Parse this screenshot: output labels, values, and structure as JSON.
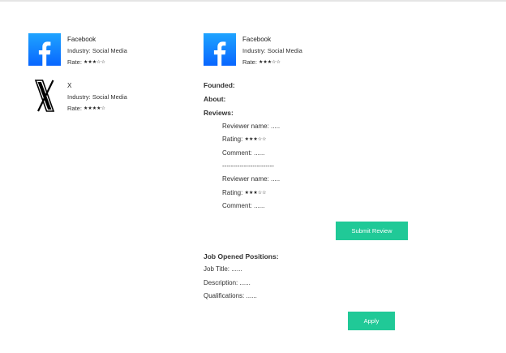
{
  "companies": [
    {
      "name": "Facebook",
      "industry": "Industry: Social Media",
      "rate_label": "Rate:",
      "stars": "★★★☆☆",
      "rating": 3,
      "logo": "facebook-logo"
    },
    {
      "name": "X",
      "industry": "Industry: Social Media",
      "rate_label": "Rate:",
      "stars": "★★★★☆",
      "rating": 4,
      "logo": "x-logo"
    }
  ],
  "selected": {
    "name": "Facebook",
    "industry": "Industry: Social Media",
    "rate_label": "Rate:",
    "stars": "★★★☆☆",
    "rating": 3,
    "logo": "facebook-logo"
  },
  "details": {
    "founded_label": "Founded:",
    "about_label": "About:",
    "reviews_label": "Reviews:",
    "reviews": [
      {
        "reviewer": "Reviewer name: .....",
        "rating_label": "Rating:",
        "stars": "★★★☆☆",
        "rating": 3,
        "comment": "Comment: ......"
      },
      {
        "reviewer": "Reviewer name: .....",
        "rating_label": "Rating:",
        "stars": "★★★☆☆",
        "rating": 3,
        "comment": "Comment: ......"
      }
    ],
    "separator": "------------------------",
    "submit_review_label": "Submit Review",
    "jobs_label": "Job Opened Positions:",
    "job_title": "Job Title: ......",
    "description": "Description: ......",
    "qualifications": "Qualifications: ......",
    "apply_label": "Apply"
  },
  "colors": {
    "accent": "#20c997",
    "facebook_blue": "#0866ff"
  }
}
